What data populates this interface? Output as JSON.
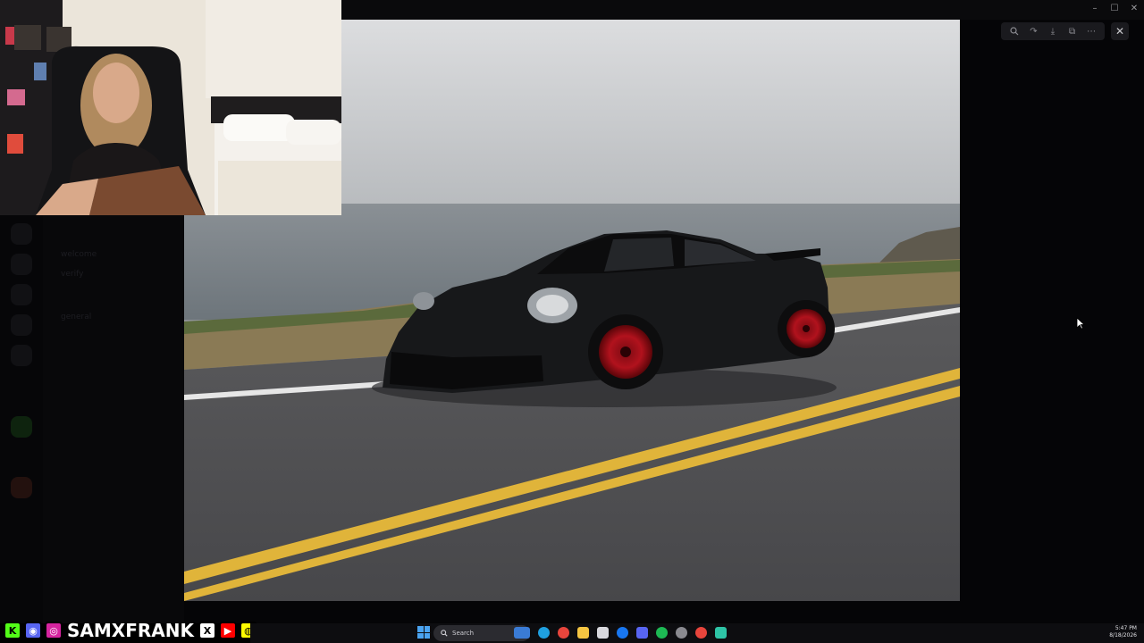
{
  "window": {
    "title": "",
    "controls": [
      "minimize",
      "maximize",
      "close"
    ]
  },
  "viewer_toolbar": {
    "icons": [
      "zoom-in-icon",
      "forward-icon",
      "download-icon",
      "open-external-icon",
      "more-icon"
    ],
    "close_icon": "close-icon"
  },
  "background_app": {
    "channels": [
      "welcome",
      "verify",
      "general",
      "",
      "",
      "",
      "",
      "",
      "",
      "",
      "",
      ""
    ]
  },
  "social_banner": {
    "handle": "SAMXFRANK",
    "icons": [
      {
        "name": "kick-icon",
        "glyph": "K",
        "color": "#53fc18"
      },
      {
        "name": "discord-icon",
        "glyph": "◉",
        "color": "#5865f2"
      },
      {
        "name": "instagram-icon",
        "glyph": "◎",
        "color": "#d6249f"
      },
      {
        "name": "x-icon",
        "glyph": "𝕏",
        "color": "#111111"
      },
      {
        "name": "youtube-icon",
        "glyph": "▶",
        "color": "#ff0000"
      },
      {
        "name": "snapchat-icon",
        "glyph": "◍",
        "color": "#fffc00"
      }
    ]
  },
  "taskbar": {
    "search_placeholder": "Search",
    "time": "5:47 PM",
    "date": "8/18/2026",
    "pinned_icons": [
      {
        "name": "widgets-icon",
        "color": "#3a7bd5"
      },
      {
        "name": "edge-icon",
        "color": "#1fa0e0"
      },
      {
        "name": "chrome-icon",
        "color": "#e8453c"
      },
      {
        "name": "file-explorer-icon",
        "color": "#f5c542"
      },
      {
        "name": "store-icon",
        "color": "#d9d9de"
      },
      {
        "name": "facebook-icon",
        "color": "#1877f2"
      },
      {
        "name": "discord-taskbar-icon",
        "color": "#5865f2"
      },
      {
        "name": "spotify-icon",
        "color": "#1db954"
      },
      {
        "name": "settings-icon",
        "color": "#8a8a90"
      },
      {
        "name": "chrome-alt-icon",
        "color": "#e8453c"
      },
      {
        "name": "app-icon",
        "color": "#2ec4a6"
      }
    ]
  },
  "colors": {
    "car_body": "#17181a",
    "wheel": "#b1121d",
    "road_line": "#e0b43a",
    "sea": "#7d8489",
    "sky": "#c9cbcd"
  }
}
